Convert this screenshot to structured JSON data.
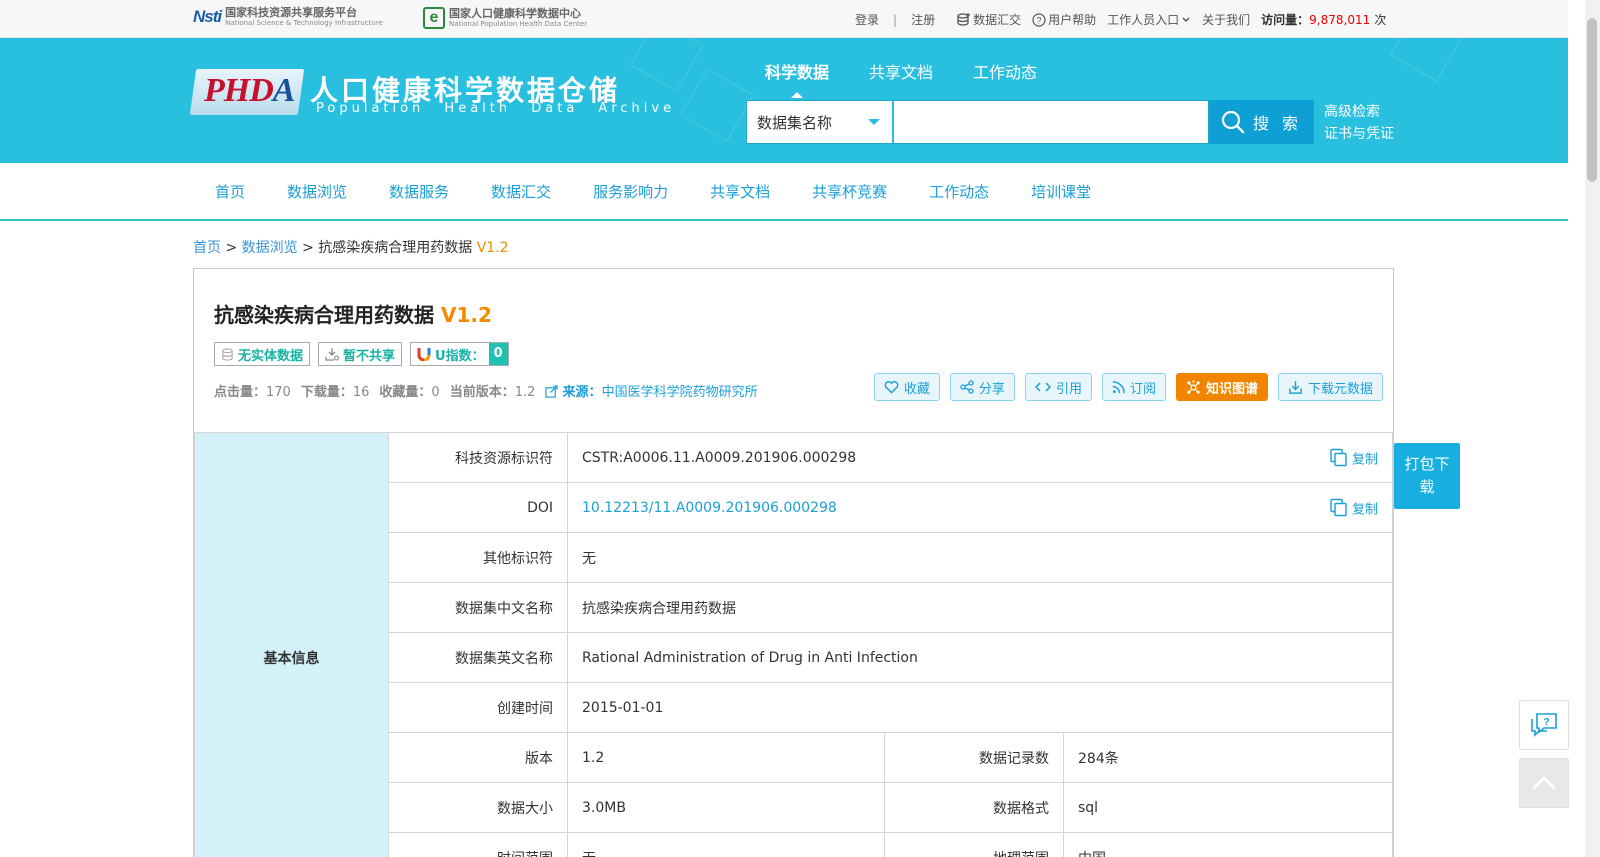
{
  "topbar": {
    "logo1_mark": "Nsti",
    "logo1_cn": "国家科技资源共享服务平台",
    "logo1_en": "National Science & Technology Infrastructure",
    "logo2_mark": "e",
    "logo2_cn": "国家人口健康科学数据中心",
    "logo2_en": "National Population Health Data Center",
    "login": "登录",
    "register": "注册",
    "data_exchange": "数据汇交",
    "help": "用户帮助",
    "staff": "工作人员入口",
    "about": "关于我们",
    "visits_label": "访问量：",
    "visits_value": "9,878,011",
    "visits_unit": "次"
  },
  "header": {
    "logo_mark_p": "PHD",
    "logo_mark_a": "A",
    "site_cn": "人口健康科学数据仓储",
    "site_en": "Population Health Data Archive",
    "nav": [
      "科学数据",
      "共享文档",
      "工作动态"
    ],
    "search_select": "数据集名称",
    "search_placeholder": "",
    "search_button": "搜 索",
    "advanced_search": "高级检索",
    "certificate": "证书与凭证"
  },
  "mainnav": [
    "首页",
    "数据浏览",
    "数据服务",
    "数据汇交",
    "服务影响力",
    "共享文档",
    "共享杯竞赛",
    "工作动态",
    "培训课堂"
  ],
  "breadcrumb": {
    "home": "首页",
    "browse": "数据浏览",
    "current": "抗感染疾病合理用药数据",
    "version": "V1.2",
    "sep": ">"
  },
  "dataset": {
    "title": "抗感染疾病合理用药数据",
    "version": "V1.2",
    "tags": {
      "entity": "无实体数据",
      "share": "暂不共享",
      "u_index_label": "U指数：",
      "u_index_value": "0"
    },
    "stats": {
      "clicks_label": "点击量：",
      "clicks": "170",
      "downloads_label": "下载量：",
      "downloads": "16",
      "favorites_label": "收藏量：",
      "favorites": "0",
      "current_version_label": "当前版本：",
      "current_version": "1.2",
      "source_label": "来源：",
      "source": "中国医学科学院药物研究所"
    },
    "actions": [
      "收藏",
      "分享",
      "引用",
      "订阅",
      "知识图谱",
      "下载元数据"
    ]
  },
  "info": {
    "section": "基本信息",
    "copy_label": "复制",
    "rows": [
      {
        "label": "科技资源标识符",
        "value": "CSTR:A0006.11.A0009.201906.000298"
      },
      {
        "label": "DOI",
        "value": "10.12213/11.A0009.201906.000298"
      },
      {
        "label": "其他标识符",
        "value": "无"
      },
      {
        "label": "数据集中文名称",
        "value": "抗感染疾病合理用药数据"
      },
      {
        "label": "数据集英文名称",
        "value": "Rational Administration of Drug in Anti Infection"
      },
      {
        "label": "创建时间",
        "value": "2015-01-01"
      }
    ],
    "pairs": [
      {
        "label1": "版本",
        "value1": "1.2",
        "label2": "数据记录数",
        "value2": "284条"
      },
      {
        "label1": "数据大小",
        "value1": "3.0MB",
        "label2": "数据格式",
        "value2": "sql"
      },
      {
        "label1": "时间范围",
        "value1": "无",
        "label2": "地理范围",
        "value2": "中国"
      }
    ]
  },
  "float": {
    "pack_download": "打包下载"
  },
  "colors": {
    "header_bg": "#29c0e0",
    "accent": "#1a9fd9",
    "version_orange": "#f08c00",
    "side_bg": "#d4f1fa"
  }
}
